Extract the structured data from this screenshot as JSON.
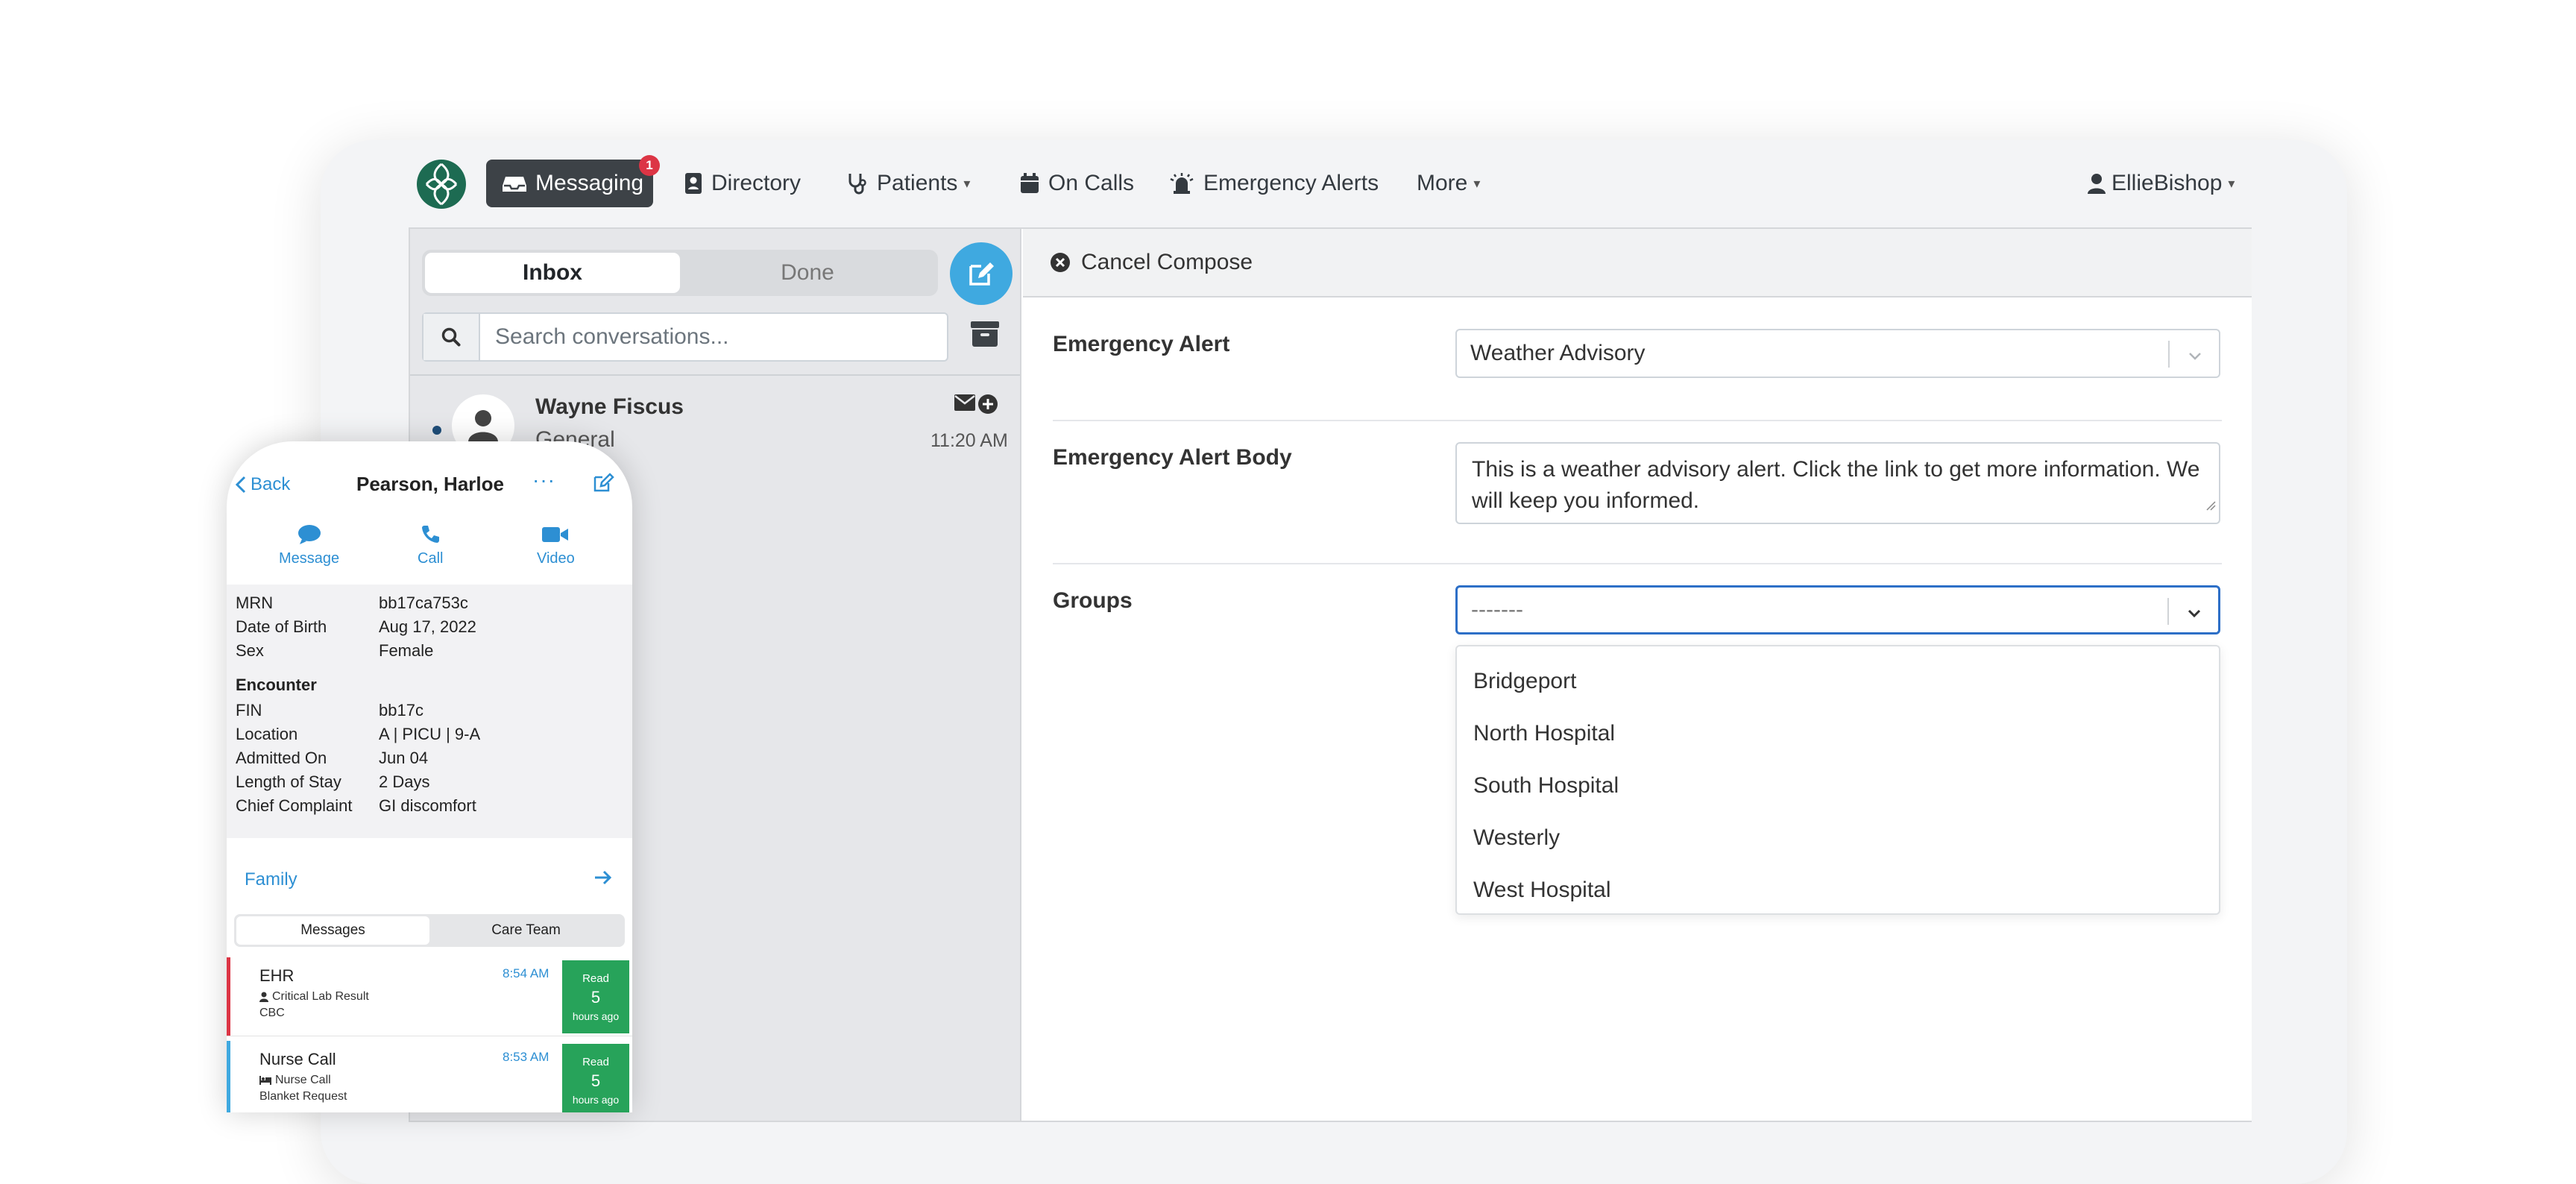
{
  "nav": {
    "messaging_label": "Messaging",
    "messaging_badge": "1",
    "directory_label": "Directory",
    "patients_label": "Patients",
    "oncalls_label": "On Calls",
    "alerts_label": "Emergency Alerts",
    "more_label": "More",
    "user_label": "EllieBishop"
  },
  "inbox": {
    "tabs": [
      "Inbox",
      "Done"
    ],
    "search_placeholder": "Search conversations...",
    "conversations": [
      {
        "name": "Wayne Fiscus",
        "subtitle": "General",
        "time": "11:20 AM",
        "unread": true
      }
    ]
  },
  "compose": {
    "cancel_label": "Cancel Compose",
    "alert_label": "Emergency Alert",
    "alert_value": "Weather Advisory",
    "body_label": "Emergency Alert Body",
    "body_value": "This is a weather advisory alert. Click the link to get more information. We will keep you informed.",
    "groups_label": "Groups",
    "groups_value": "-------",
    "groups_options": [
      "Bridgeport",
      "North Hospital",
      "South Hospital",
      "Westerly",
      "West Hospital"
    ]
  },
  "phone": {
    "back_label": "Back",
    "title": "Pearson, Harloe",
    "actions": [
      "Message",
      "Call",
      "Video"
    ],
    "patient": [
      {
        "key": "MRN",
        "value": "bb17ca753c"
      },
      {
        "key": "Date of Birth",
        "value": "Aug 17, 2022"
      },
      {
        "key": "Sex",
        "value": "Female"
      }
    ],
    "encounter_heading": "Encounter",
    "encounter": [
      {
        "key": "FIN",
        "value": "bb17c"
      },
      {
        "key": "Location",
        "value": "A | PICU | 9-A"
      },
      {
        "key": "Admitted On",
        "value": "Jun 04"
      },
      {
        "key": "Length of Stay",
        "value": "2 Days"
      },
      {
        "key": "Chief Complaint",
        "value": "GI discomfort"
      }
    ],
    "family_label": "Family",
    "segments": [
      "Messages",
      "Care Team"
    ],
    "messages": [
      {
        "title": "EHR",
        "subtitle": "Critical Lab Result",
        "detail": "CBC",
        "time": "8:54 AM",
        "status": "Read",
        "count": "5",
        "ago": "hours ago",
        "accent": "#dc3545"
      },
      {
        "title": "Nurse Call",
        "subtitle": "Nurse Call",
        "detail": "Blanket Request",
        "time": "8:53 AM",
        "status": "Read",
        "count": "5",
        "ago": "hours ago",
        "accent": "#3fa9e0"
      }
    ]
  },
  "colors": {
    "brand": "#1d6b52",
    "accent": "#3fa9e0",
    "nav_active": "#3d4247",
    "badge": "#dc3545",
    "read_badge": "#27a35a",
    "focus": "#2d6fc7"
  }
}
